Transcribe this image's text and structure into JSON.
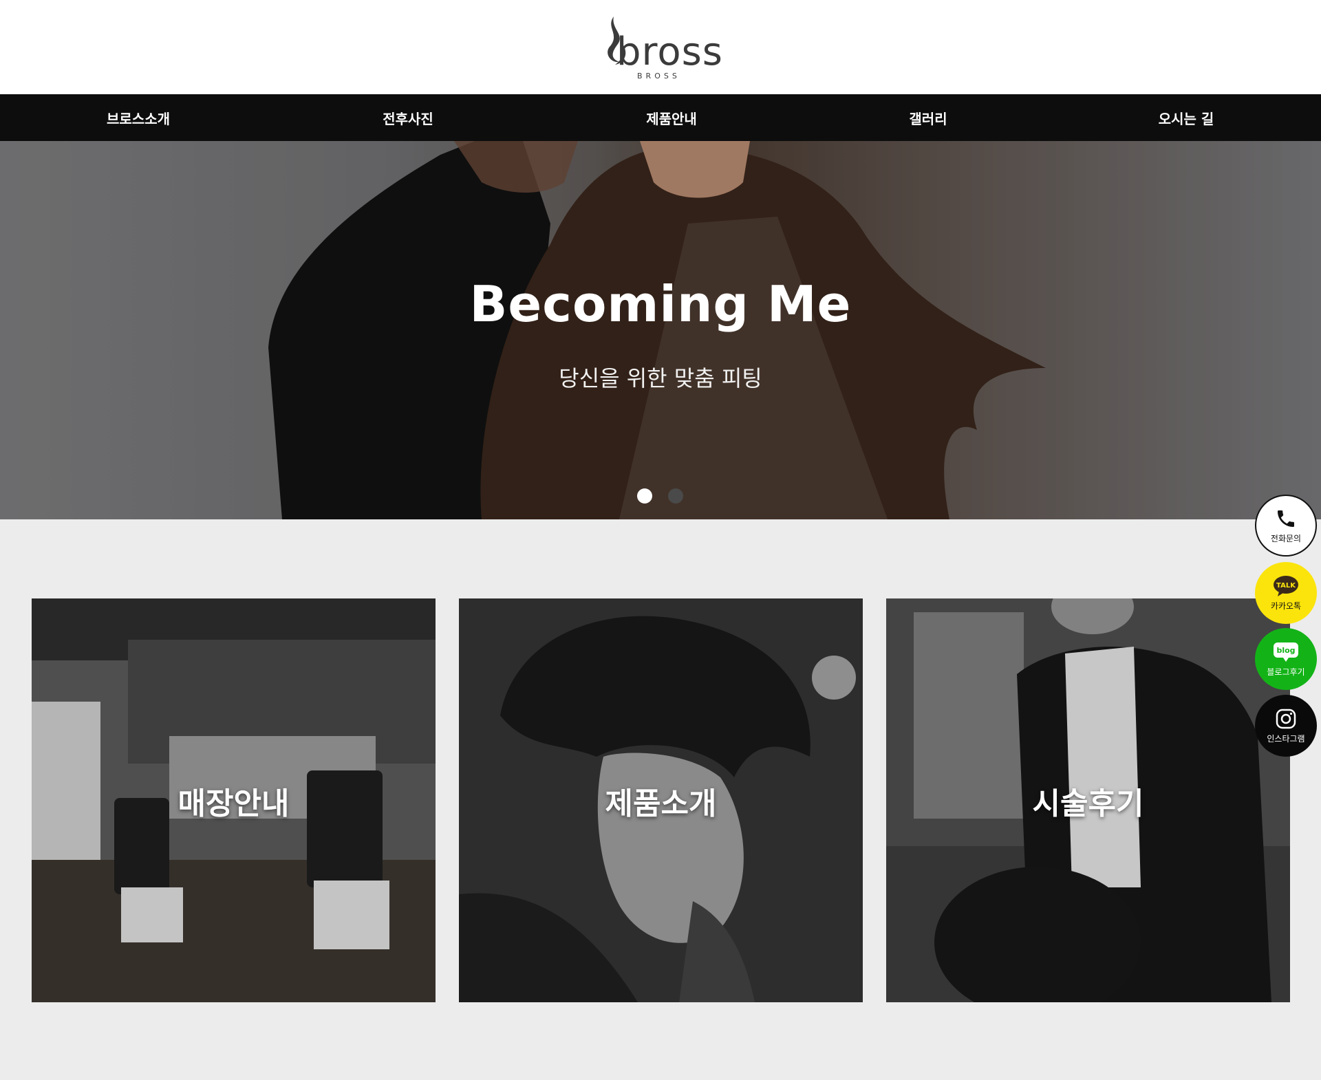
{
  "header": {
    "logo_text": "bross",
    "logo_subtext": "BROSS"
  },
  "nav": {
    "items": [
      {
        "label": "브로스소개"
      },
      {
        "label": "전후사진"
      },
      {
        "label": "제품안내"
      },
      {
        "label": "갤러리"
      },
      {
        "label": "오시는 길"
      }
    ]
  },
  "hero": {
    "title": "Becoming Me",
    "subtitle": "당신을 위한 맞춤 피팅",
    "slide_count": 2,
    "active_slide": 1
  },
  "cards": [
    {
      "label": "매장안내"
    },
    {
      "label": "제품소개"
    },
    {
      "label": "시술후기"
    }
  ],
  "floating": {
    "phone": {
      "label": "전화문의",
      "icon": "phone-icon"
    },
    "kakao": {
      "label": "카카오톡",
      "icon_text": "TALK",
      "icon": "kakao-talk-icon"
    },
    "blog": {
      "label": "블로그후기",
      "icon_text": "blog",
      "icon": "blog-icon"
    },
    "instagram": {
      "label": "인스타그램",
      "icon": "instagram-icon"
    }
  },
  "colors": {
    "nav_bg": "#0d0d0d",
    "kakao": "#fbe40b",
    "blog": "#13b317",
    "page_bg": "#ececec"
  }
}
